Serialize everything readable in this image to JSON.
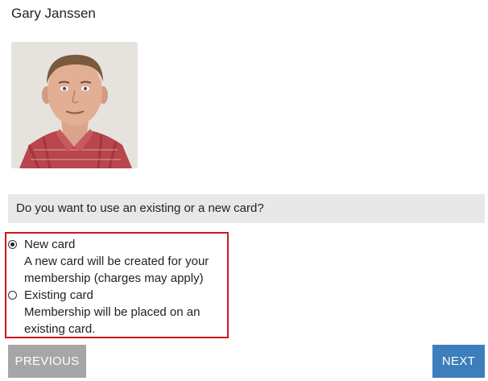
{
  "member": {
    "name": "Gary Janssen",
    "photo_icon": "member-photo"
  },
  "question": {
    "text": "Do you want to use an existing or a new card?"
  },
  "options": [
    {
      "title": "New card",
      "description": "A new card will be created for your membership (charges may apply)",
      "selected": true
    },
    {
      "title": "Existing card",
      "description": "Membership will be placed on an existing card.",
      "selected": false
    }
  ],
  "buttons": {
    "previous_label": "PREVIOUS",
    "next_label": "NEXT"
  },
  "colors": {
    "highlight_border": "#d0161d",
    "next_button": "#3d7fbc",
    "previous_button": "#a6a6a6",
    "question_bar": "#e8e8e8"
  }
}
